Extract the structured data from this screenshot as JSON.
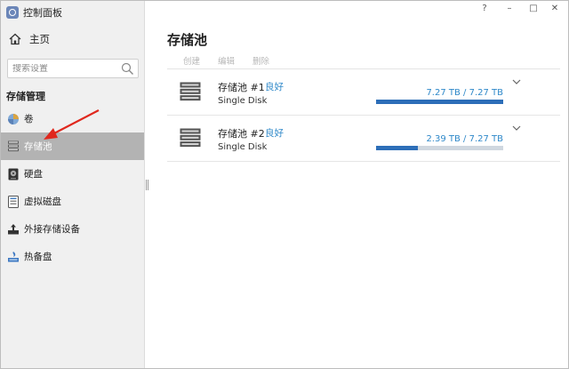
{
  "window": {
    "title": "控制面板",
    "controls": {
      "help": "?",
      "minimize": "–",
      "maximize": "□",
      "close": "✕"
    }
  },
  "sidebar": {
    "home_label": "主页",
    "search_placeholder": "搜索设置",
    "section_header": "存储管理",
    "items": [
      {
        "label": "卷",
        "icon": "volume-icon",
        "active": false
      },
      {
        "label": "存储池",
        "icon": "storage-pool-icon",
        "active": true
      },
      {
        "label": "硬盘",
        "icon": "hard-disk-icon",
        "active": false
      },
      {
        "label": "虚拟磁盘",
        "icon": "virtual-disk-icon",
        "active": false
      },
      {
        "label": "外接存储设备",
        "icon": "external-storage-icon",
        "active": false
      },
      {
        "label": "热备盘",
        "icon": "hot-spare-icon",
        "active": false
      }
    ],
    "active_color": "#b3b3b3"
  },
  "main": {
    "title": "存储池",
    "toolbar": {
      "create": "创建",
      "edit": "编辑",
      "delete": "删除"
    },
    "pools": [
      {
        "name": "存储池 #1",
        "status": "良好",
        "type": "Single Disk",
        "capacity": "7.27 TB / 7.27 TB",
        "used_fraction": 1.0
      },
      {
        "name": "存储池 #2",
        "status": "良好",
        "type": "Single Disk",
        "capacity": "2.39 TB / 7.27 TB",
        "used_fraction": 0.329
      }
    ],
    "status_color": "#2e88c9",
    "bar_color": "#2d6eb8"
  },
  "annotation": {
    "arrow_color": "#e0281e"
  }
}
